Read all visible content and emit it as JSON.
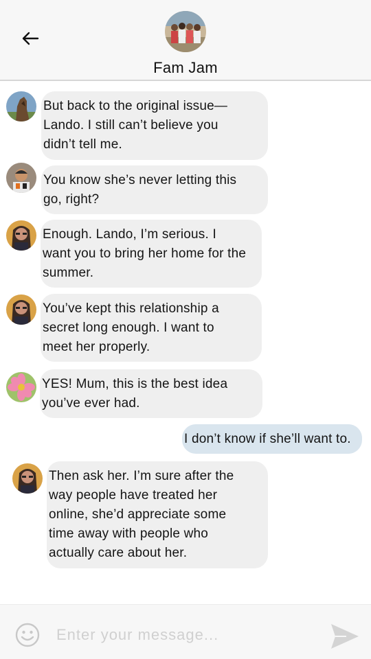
{
  "header": {
    "title": "Fam Jam",
    "back_icon": "arrow-left-icon"
  },
  "messages": [
    {
      "sender": "other",
      "avatar": "horse-photo",
      "text": "But back to the original issue—\nLando. I still can’t believe you\ndidn’t tell me."
    },
    {
      "sender": "other",
      "avatar": "racing-driver-photo",
      "text": "You know she’s never letting this\ngo, right?"
    },
    {
      "sender": "other",
      "avatar": "woman-glasses-photo",
      "text": "Enough. Lando, I’m serious. I\nwant you to bring her home for the\nsummer."
    },
    {
      "sender": "other",
      "avatar": "woman-glasses-photo",
      "text": "You’ve kept this relationship a\nsecret long enough. I want to\nmeet her properly."
    },
    {
      "sender": "other",
      "avatar": "pink-flower-photo",
      "text": "YES! Mum, this is the best idea\nyou’ve ever had."
    },
    {
      "sender": "me",
      "text": "I don’t know if she’ll want to."
    },
    {
      "sender": "other",
      "avatar": "woman-glasses-photo",
      "text": "Then ask her. I’m sure after the\nway people have treated her\nonline, she’d appreciate some\ntime away with people who\nactually care about her."
    }
  ],
  "composer": {
    "placeholder": "Enter your message...",
    "value": "",
    "emoji_icon": "smiley-icon",
    "send_icon": "send-icon"
  },
  "colors": {
    "incoming_bubble": "#efefef",
    "outgoing_bubble": "#d9e5ee",
    "header_bg": "#f7f7f7",
    "placeholder": "#d0d0d0"
  }
}
